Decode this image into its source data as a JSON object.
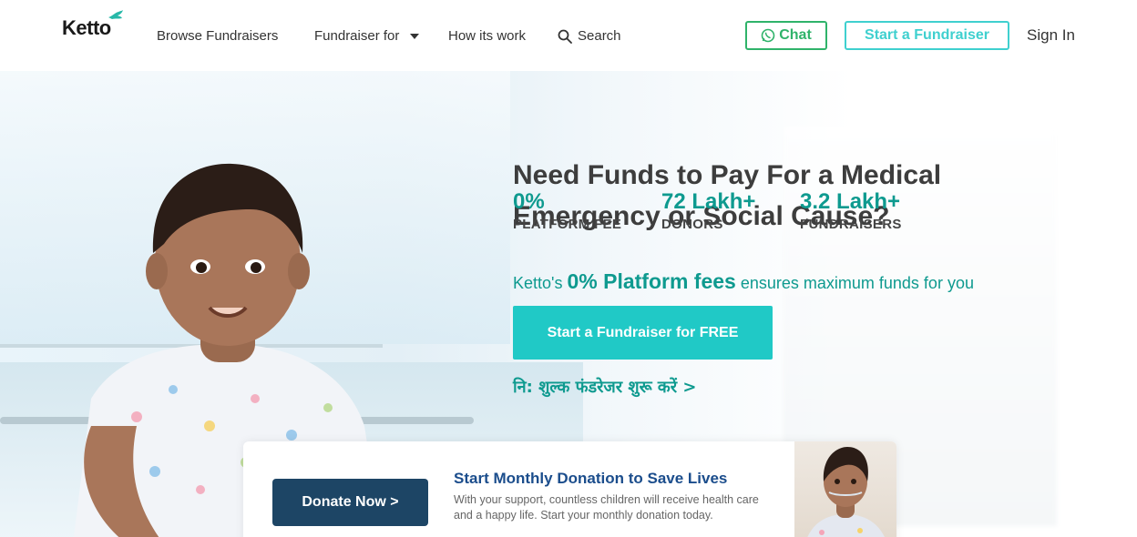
{
  "header": {
    "logo": "Ketto",
    "nav": {
      "browse": "Browse Fundraisers",
      "fundraiser_for": "Fundraiser for",
      "how_it_works": "How its work",
      "search": "Search"
    },
    "chat_label": "Chat",
    "start_label": "Start a Fundraiser",
    "signin_label": "Sign In"
  },
  "hero": {
    "title_line1": "Need Funds to Pay For a Medical",
    "title_line2": "Emergency or Social Cause?",
    "stats": [
      {
        "value": "0%",
        "label": "PLATFORM FEE"
      },
      {
        "value": "72 Lakh+",
        "label": "DONORS"
      },
      {
        "value": "3.2 Lakh+",
        "label": "FUNDRAISERS"
      }
    ],
    "tagline_prefix": "Ketto's",
    "tagline_bold": "0% Platform fees",
    "tagline_suffix": "ensures maximum funds for you",
    "cta_label": "Start a Fundraiser for FREE",
    "hindi_link": "नि: शुल्क फंडरेजर शुरू करें >"
  },
  "monthly": {
    "donate_label": "Donate Now >",
    "title": "Start Monthly Donation to Save Lives",
    "text": "With your support, countless children will receive health care and a happy life. Start your monthly donation today."
  },
  "colors": {
    "teal": "#0e9a8f",
    "cta": "#20c9c6",
    "whatsapp": "#2fb36a",
    "navy": "#1d4565"
  }
}
